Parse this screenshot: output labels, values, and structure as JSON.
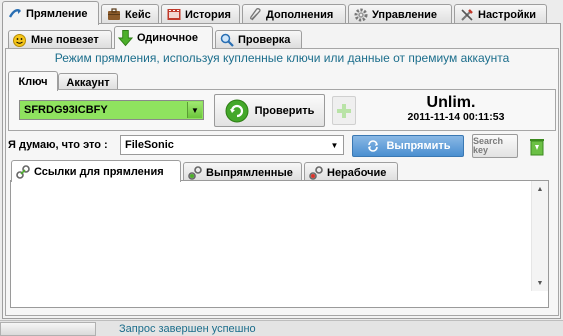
{
  "top_tabs": [
    {
      "label": "Прямление",
      "icon": "unrestrict-icon"
    },
    {
      "label": "Кейс",
      "icon": "briefcase-icon"
    },
    {
      "label": "История",
      "icon": "history-icon"
    },
    {
      "label": "Дополнения",
      "icon": "paperclip-icon"
    },
    {
      "label": "Управление",
      "icon": "gear-icon"
    },
    {
      "label": "Настройки",
      "icon": "tools-icon"
    }
  ],
  "sub_tabs": [
    {
      "label": "Мне повезет",
      "icon": "smiley-icon"
    },
    {
      "label": "Одиночное",
      "icon": "green-arrow-down-icon"
    },
    {
      "label": "Проверка",
      "icon": "magnifier-icon"
    }
  ],
  "mode_text": "Режим прямления, используя купленные ключи или данные от премиум аккаунта",
  "key_tabs": [
    "Ключ",
    "Аккаунт"
  ],
  "key_combo_value": "SFRDG93ICBFY",
  "check_button": "Проверить",
  "plus_icon": "plus-icon",
  "account_status": "Unlim.",
  "expiry": "2011-11-14 00:11:53",
  "host_label": "Я думаю, что это :",
  "host_value": "FileSonic",
  "straighten_button": "Выпрямить",
  "search_key_button": "Search key",
  "trash_icon": "recycle-bin-icon",
  "link_tabs": [
    {
      "label": "Ссылки для прямления",
      "icon": "links-icon"
    },
    {
      "label": "Выпрямленные",
      "icon": "links-ok-icon"
    },
    {
      "label": "Нерабочие",
      "icon": "links-broken-icon"
    }
  ],
  "status_text": "Запрос завершен успешно",
  "colors": {
    "accent_text": "#1c6e8c",
    "key_combo_bg": "#8fe35f",
    "straighten_button_bg": "#4a8fd0",
    "status_text": "#1c6e8c"
  }
}
